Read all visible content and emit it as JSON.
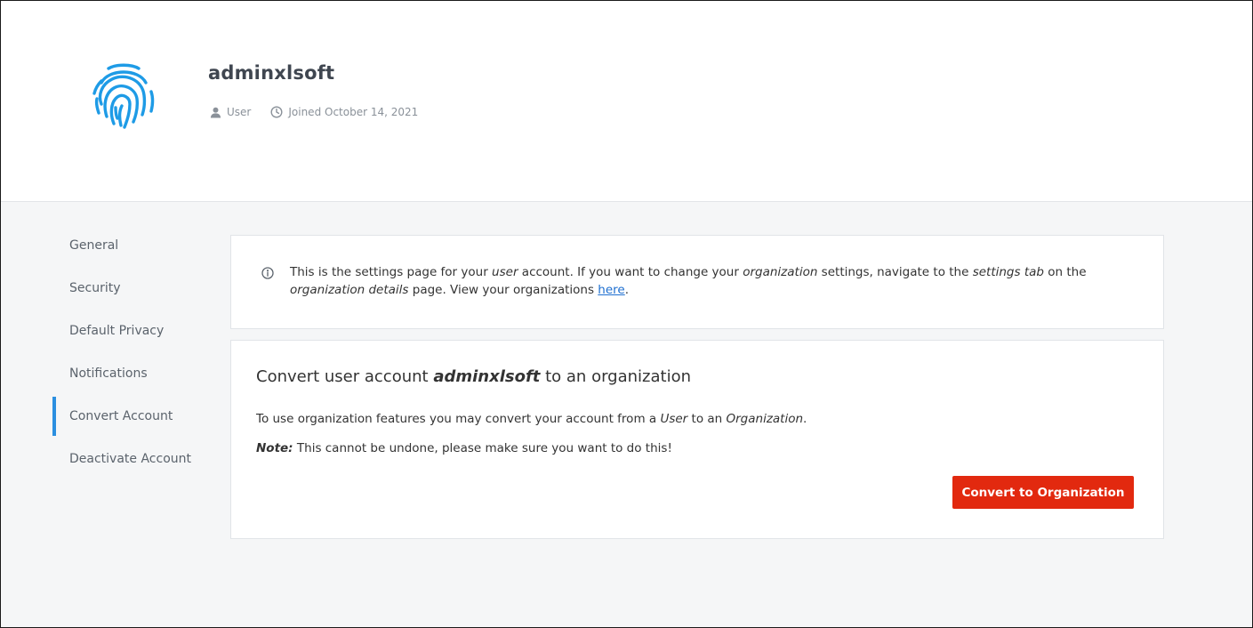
{
  "profile": {
    "username": "adminxlsoft",
    "role": "User",
    "joined": "Joined October 14, 2021",
    "avatar_icon": "fingerprint-icon",
    "accent_color": "#1e9be6"
  },
  "sidebar": {
    "items": [
      {
        "label": "General"
      },
      {
        "label": "Security"
      },
      {
        "label": "Default Privacy"
      },
      {
        "label": "Notifications"
      },
      {
        "label": "Convert Account",
        "active": true
      },
      {
        "label": "Deactivate Account"
      }
    ]
  },
  "info": {
    "p1": "This is the settings page for your ",
    "e1": "user",
    "p2": " account. If you want to change your ",
    "e2": "organization",
    "p3": " settings, navigate to the ",
    "e3": "settings tab",
    "p4": " on the ",
    "e4": "organization details",
    "p5": " page. View your organizations ",
    "link": "here",
    "p6": "."
  },
  "convert": {
    "title_prefix": "Convert user account ",
    "title_user": "adminxlsoft",
    "title_suffix": " to an organization",
    "desc_prefix": "To use organization features you may convert your account from a ",
    "desc_user": "User",
    "desc_mid": " to an ",
    "desc_org": "Organization",
    "desc_end": ".",
    "note_label": "Note:",
    "note_text": " This cannot be undone, please make sure you want to do this!",
    "button_label": "Convert to Organization",
    "button_color": "#e2290f"
  }
}
